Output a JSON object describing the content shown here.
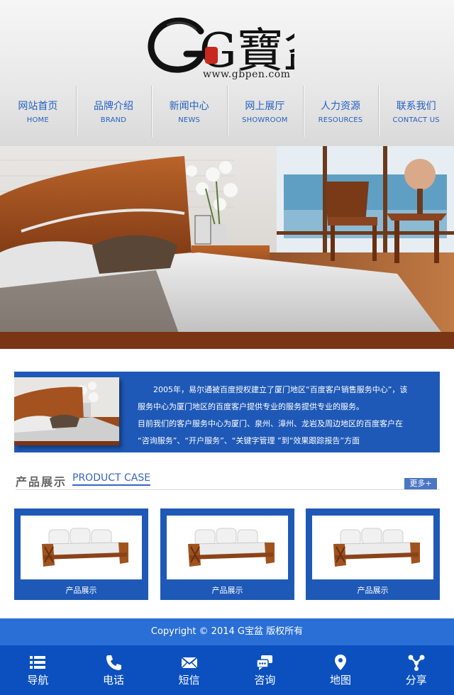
{
  "header": {
    "logo_text": "G寶盆",
    "site_url": "www.gbpen.com"
  },
  "nav": {
    "items": [
      {
        "cn": "网站首页",
        "en": "HOME"
      },
      {
        "cn": "品牌介绍",
        "en": "BRAND"
      },
      {
        "cn": "新闻中心",
        "en": "NEWS"
      },
      {
        "cn": "网上展厅",
        "en": "SHOWROOM"
      },
      {
        "cn": "人力资源",
        "en": "RESOURCES"
      },
      {
        "cn": "联系我们",
        "en": "CONTACT US"
      }
    ]
  },
  "about": {
    "lines": [
      "　　2005年，易尔通被百度授权建立了厦门地区“百度客户销售服务中心”，该",
      "服务中心为厦门地区的百度客户提供专业的服务提供专业的服务。",
      "目前我们的客户服务中心为厦门、泉州、漳州、龙岩及周边地区的百度客户在",
      "“咨询服务”、“开户服务”、“关键字管理 ”到“效果跟踪报告”方面"
    ]
  },
  "products_section": {
    "title_cn": "产品展示",
    "title_en": "PRODUCT CASE",
    "more_label": "更多+",
    "items": [
      {
        "label": "产品展示"
      },
      {
        "label": "产品展示"
      },
      {
        "label": "产品展示"
      }
    ]
  },
  "footer": {
    "copyright": "Copyright © 2014 G宝盆 版权所有"
  },
  "bottom_bar": {
    "items": [
      {
        "label": "导航",
        "icon": "menu-icon"
      },
      {
        "label": "电话",
        "icon": "phone-icon"
      },
      {
        "label": "短信",
        "icon": "envelope-icon"
      },
      {
        "label": "咨询",
        "icon": "chat-icon"
      },
      {
        "label": "地图",
        "icon": "map-pin-icon"
      },
      {
        "label": "分享",
        "icon": "share-icon"
      }
    ]
  },
  "colors": {
    "brand_blue": "#1f59b7",
    "nav_text": "#2461c0",
    "bottom_bar": "#0b50be"
  }
}
